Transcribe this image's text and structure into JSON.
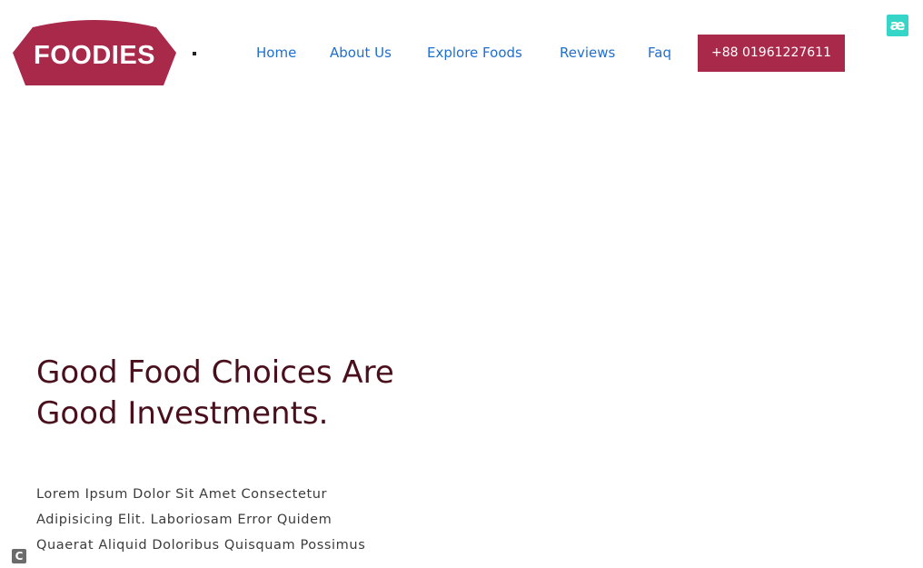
{
  "header": {
    "logo_text": "FOODIES",
    "nav": [
      {
        "label": "Home"
      },
      {
        "label": "About Us"
      },
      {
        "label": "Explore Foods"
      },
      {
        "label": "Reviews"
      },
      {
        "label": "Faq"
      }
    ],
    "phone_button": "+88 01961227611"
  },
  "hero": {
    "title": "Good Food Choices Are Good Investments.",
    "text": "Lorem Ipsum Dolor Sit Amet Consectetur Adipisicing Elit. Laboriosam Error Quidem Quaerat Aliquid Doloribus Quisquam Possimus"
  },
  "icons": {
    "extension_icon": "æ",
    "corner_icon": "C"
  },
  "colors": {
    "brand": "#a8294a",
    "nav_link": "#1f6fd1",
    "hero_title": "#4a0f1c",
    "extension": "#35d6c8"
  }
}
